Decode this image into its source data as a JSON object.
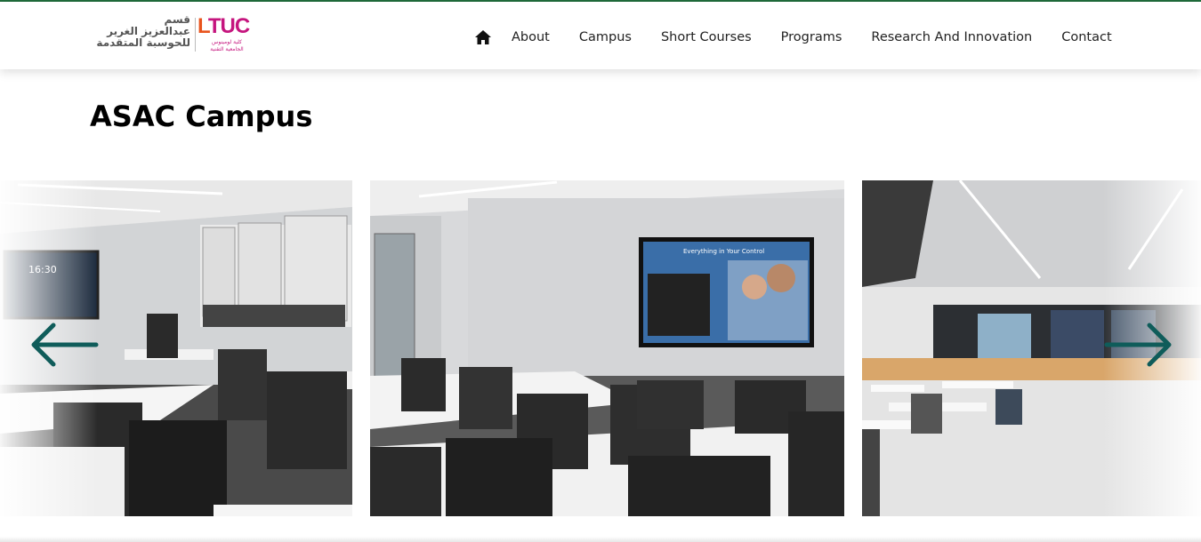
{
  "header": {
    "logo": {
      "arabic_lines": [
        "قسم",
        "عبدالعزيز الغرير",
        "للحوسبة المتقدمة"
      ],
      "brand": "LTUC",
      "brand_first_letter": "L",
      "brand_rest": "TUC",
      "brand_arabic": [
        "كلية لومينوس",
        "الجامعية التقنية"
      ],
      "brand_colors": {
        "L": "#e8541d",
        "TUC": "#c5157e"
      }
    },
    "nav": {
      "home_icon": "home-icon",
      "items": [
        {
          "label": "About"
        },
        {
          "label": "Campus"
        },
        {
          "label": "Short Courses"
        },
        {
          "label": "Programs"
        },
        {
          "label": "Research And Innovation"
        },
        {
          "label": "Contact"
        }
      ]
    }
  },
  "main": {
    "title": "ASAC Campus",
    "carousel": {
      "prev_icon": "arrow-left-icon",
      "next_icon": "arrow-right-icon",
      "arrow_color": "#0f5c5a",
      "slides": [
        {
          "screen_time": "16:30"
        },
        {
          "screen_heading": "Everything in Your Control"
        },
        {
          "screen_heading": ""
        }
      ]
    }
  },
  "colors": {
    "top_line": "#1f6b3a",
    "text": "#222222"
  }
}
